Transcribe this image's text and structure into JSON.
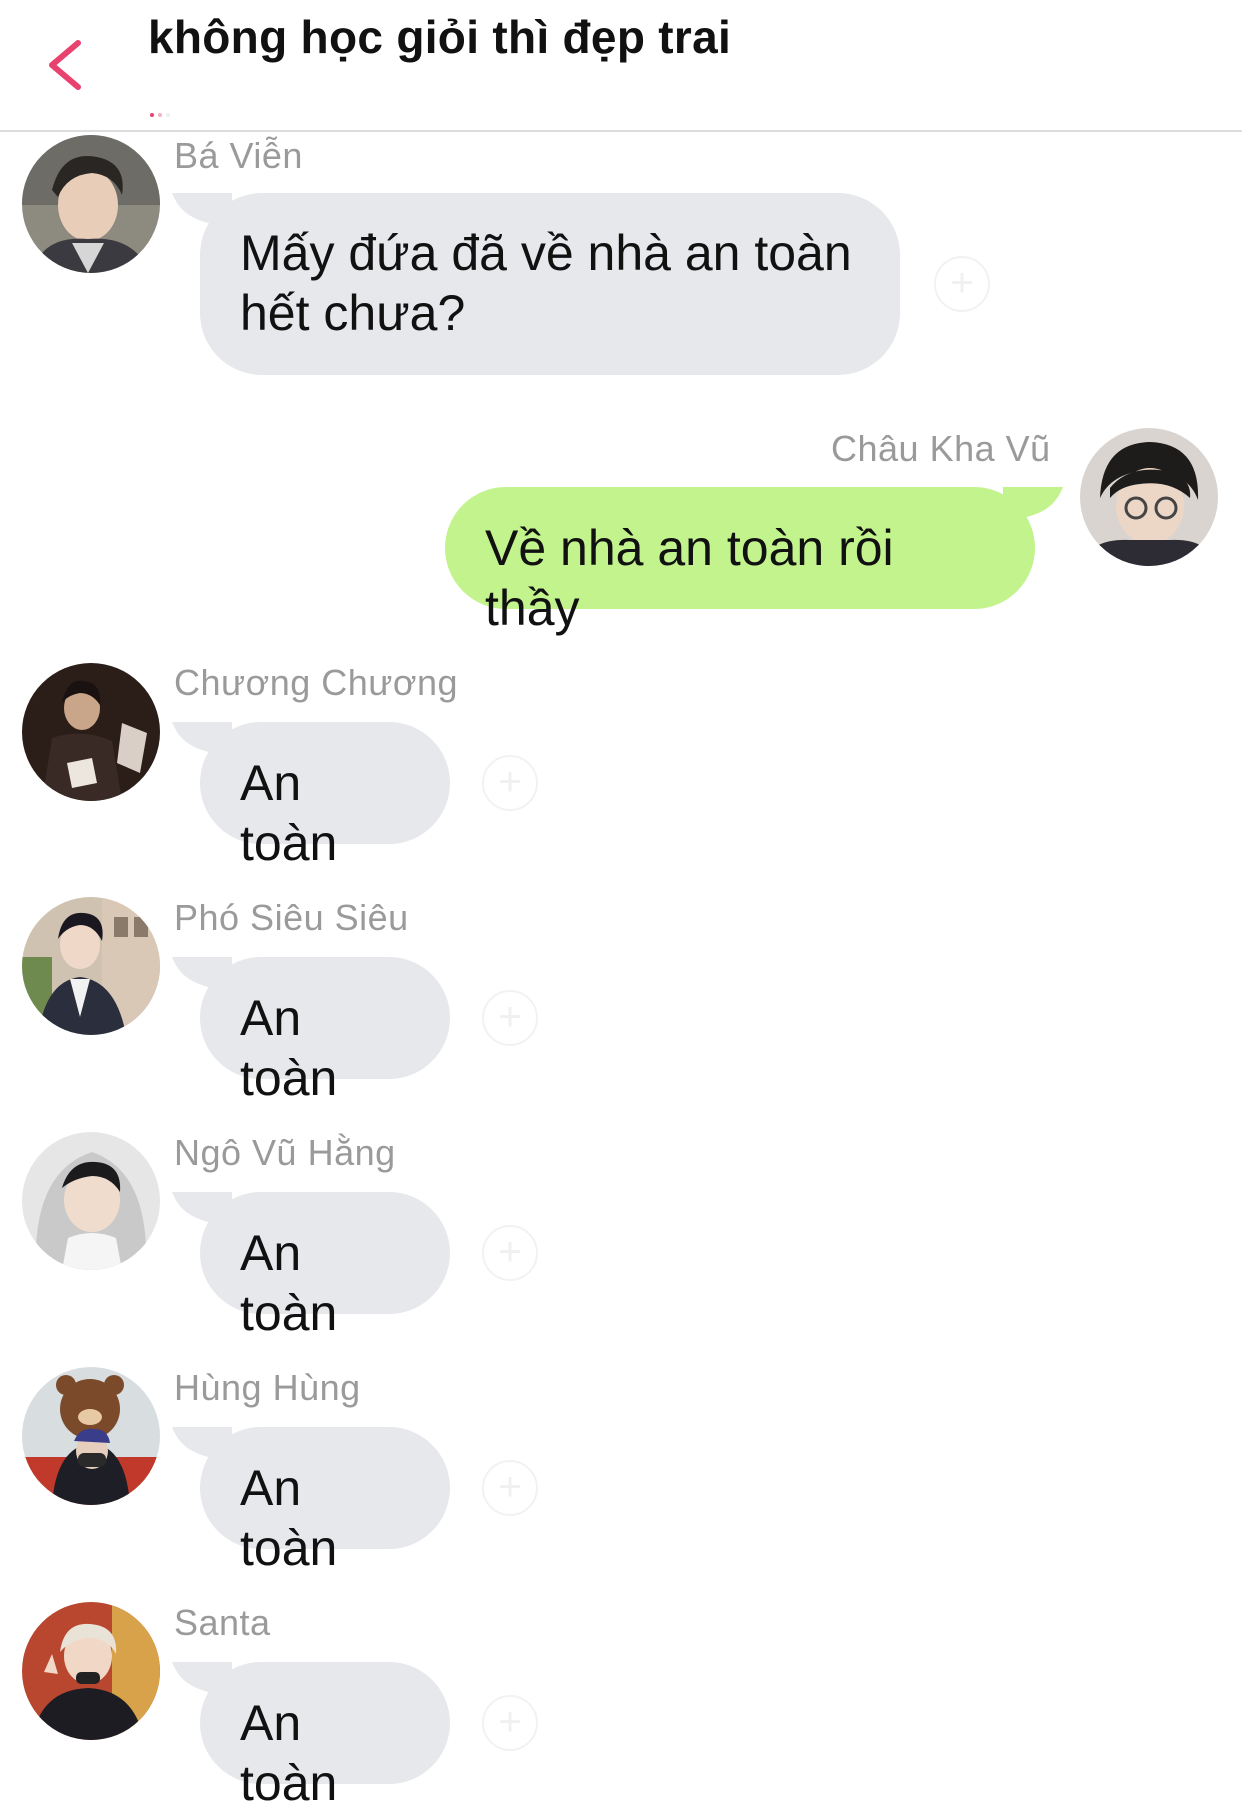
{
  "header": {
    "title": "không học giỏi thì đẹp trai",
    "back_icon": "chevron-left-icon",
    "accent_color": "#e8436f"
  },
  "colors": {
    "incoming_bubble": "#e6e8eb",
    "outgoing_bubble": "#c2f38c",
    "sender_name": "#9a9a9a"
  },
  "messages": [
    {
      "sender": "Bá Viễn",
      "text_line1": "Mấy đứa đã về nhà an toàn",
      "text_line2": "hết chưa?",
      "direction": "incoming"
    },
    {
      "sender": "Châu Kha Vũ",
      "text": "Về nhà an toàn rồi thầy",
      "direction": "outgoing"
    },
    {
      "sender": "Chương Chương",
      "text": "An toàn",
      "direction": "incoming"
    },
    {
      "sender": "Phó Siêu Siêu",
      "text": "An toàn",
      "direction": "incoming"
    },
    {
      "sender": "Ngô Vũ Hằng",
      "text": "An toàn",
      "direction": "incoming"
    },
    {
      "sender": "Hùng Hùng",
      "text": "An toàn",
      "direction": "incoming"
    },
    {
      "sender": "Santa",
      "text": "An toàn",
      "direction": "incoming"
    }
  ],
  "react_icon": "add-reaction-icon"
}
